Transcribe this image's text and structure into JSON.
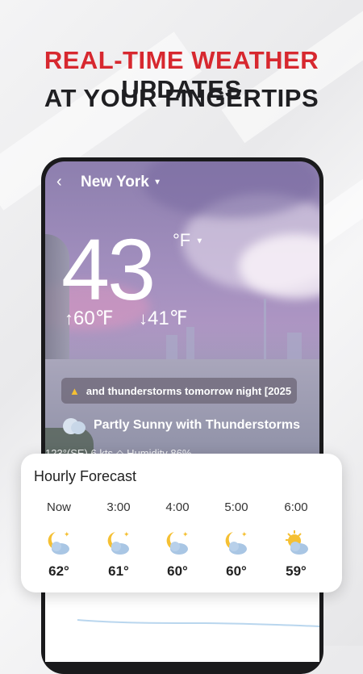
{
  "headline": {
    "highlight": "REAL-TIME WEATHER",
    "rest_line1": "UPDATES",
    "line2": "AT YOUR FINGERTIPS"
  },
  "app": {
    "location": "New York",
    "temperature": "43",
    "unit": "°F",
    "high": "60℉",
    "low": "41℉",
    "alert_text": "and thunderstorms tomorrow night [2025",
    "condition": "Partly Sunny with Thunderstorms",
    "wind_humidity": "123°(SE) 6 kts  ◇ Humidity 86%"
  },
  "hourly": {
    "title": "Hourly Forecast",
    "items": [
      {
        "time": "Now",
        "icon": "partly-cloudy-night-icon",
        "temp": "62°"
      },
      {
        "time": "3:00",
        "icon": "partly-cloudy-night-icon",
        "temp": "61°"
      },
      {
        "time": "4:00",
        "icon": "partly-cloudy-night-icon",
        "temp": "60°"
      },
      {
        "time": "5:00",
        "icon": "partly-cloudy-night-icon",
        "temp": "60°"
      },
      {
        "time": "6:00",
        "icon": "partly-sunny-icon",
        "temp": "59°"
      }
    ]
  },
  "colors": {
    "accent_red": "#d7282f",
    "dark_text": "#1f1f22",
    "moon_yellow": "#f5c033",
    "cloud_blue": "#a9c6e4"
  }
}
